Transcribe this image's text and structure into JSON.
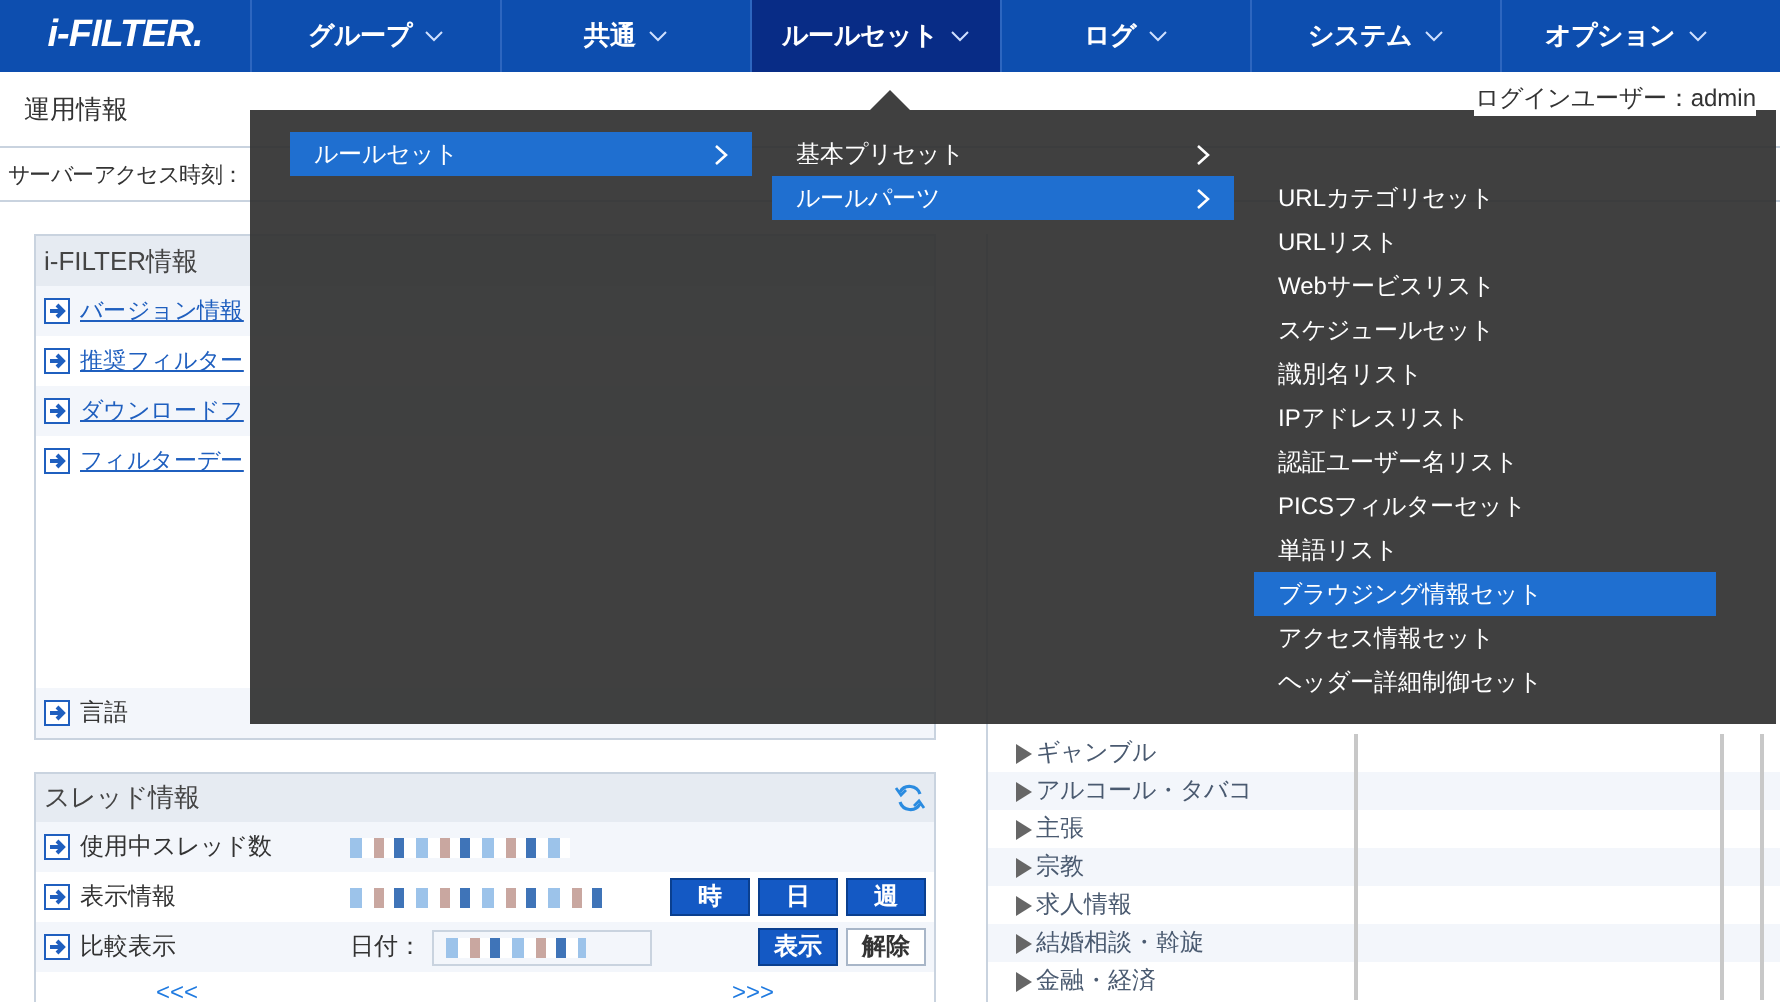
{
  "header": {
    "logo": "i-FILTER.",
    "nav": [
      {
        "label": "グループ",
        "selected": false
      },
      {
        "label": "共通",
        "selected": false
      },
      {
        "label": "ルールセット",
        "selected": true
      },
      {
        "label": "ログ",
        "selected": false
      },
      {
        "label": "システム",
        "selected": false
      },
      {
        "label": "オプション",
        "selected": false
      }
    ]
  },
  "page_title": "運用情報",
  "login_user": "ログインユーザー：admin",
  "server_time_label": "サーバーアクセス時刻：",
  "ifilter_info": {
    "title": "i-FILTER情報",
    "links": [
      "バージョン情報",
      "推奨フィルター",
      "ダウンロードフ",
      "フィルターデー"
    ],
    "language_label": "言語"
  },
  "thread_info": {
    "title": "スレッド情報",
    "rows": [
      "使用中スレッド数",
      "表示情報",
      "比較表示"
    ],
    "period_buttons": [
      {
        "label": "時",
        "kind": "primary"
      },
      {
        "label": "日",
        "kind": "primary"
      },
      {
        "label": "週",
        "kind": "primary"
      }
    ],
    "date_label": "日付：",
    "compare_buttons": [
      {
        "label": "表示",
        "kind": "primary"
      },
      {
        "label": "解除",
        "kind": "secondary"
      }
    ],
    "prev": "<<<",
    "next": ">>>"
  },
  "access_info": {
    "categories": [
      "ギャンブル",
      "アルコール・タバコ",
      "主張",
      "宗教",
      "求人情報",
      "結婚相談・斡旋",
      "金融・経済"
    ]
  },
  "menu": {
    "columns": [
      [
        {
          "label": "ルールセット",
          "selected": true,
          "submenu": true
        }
      ],
      [
        {
          "label": "基本プリセット",
          "selected": false,
          "submenu": true
        },
        {
          "label": "ルールパーツ",
          "selected": true,
          "submenu": true
        }
      ],
      [
        {
          "label": "URLカテゴリセット",
          "selected": false,
          "submenu": false
        },
        {
          "label": "URLリスト",
          "selected": false,
          "submenu": false
        },
        {
          "label": "Webサービスリスト",
          "selected": false,
          "submenu": false
        },
        {
          "label": "スケジュールセット",
          "selected": false,
          "submenu": false
        },
        {
          "label": "識別名リスト",
          "selected": false,
          "submenu": false
        },
        {
          "label": "IPアドレスリスト",
          "selected": false,
          "submenu": false
        },
        {
          "label": "認証ユーザー名リスト",
          "selected": false,
          "submenu": false
        },
        {
          "label": "PICSフィルターセット",
          "selected": false,
          "submenu": false
        },
        {
          "label": "単語リスト",
          "selected": false,
          "submenu": false
        },
        {
          "label": "ブラウジング情報セット",
          "selected": true,
          "submenu": false
        },
        {
          "label": "アクセス情報セット",
          "selected": false,
          "submenu": false
        },
        {
          "label": "ヘッダー詳細制御セット",
          "selected": false,
          "submenu": false
        }
      ]
    ]
  }
}
